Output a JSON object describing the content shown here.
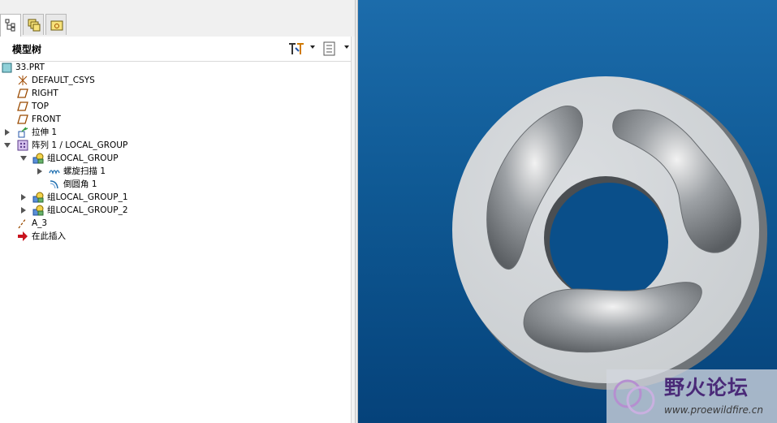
{
  "panel": {
    "title": "模型树"
  },
  "tabs": [
    {
      "icon": "model-tree-tab-icon",
      "active": true
    },
    {
      "icon": "layers-tab-icon",
      "active": false
    },
    {
      "icon": "folder-tab-icon",
      "active": false
    }
  ],
  "tree": {
    "root": "33.PRT",
    "items": [
      {
        "label": "DEFAULT_CSYS",
        "icon": "csys-icon"
      },
      {
        "label": "RIGHT",
        "icon": "datum-plane-icon"
      },
      {
        "label": "TOP",
        "icon": "datum-plane-icon"
      },
      {
        "label": "FRONT",
        "icon": "datum-plane-icon"
      },
      {
        "label": "拉伸 1",
        "icon": "extrude-icon",
        "expander": "collapsed"
      },
      {
        "label": "阵列 1 / LOCAL_GROUP",
        "icon": "pattern-icon",
        "expander": "expanded"
      },
      {
        "label": "组LOCAL_GROUP",
        "icon": "group-icon",
        "expander": "expanded"
      },
      {
        "label": "螺旋扫描 1",
        "icon": "helical-sweep-icon",
        "expander": "collapsed"
      },
      {
        "label": "倒圆角 1",
        "icon": "round-icon"
      },
      {
        "label": "组LOCAL_GROUP_1",
        "icon": "group-icon",
        "expander": "collapsed"
      },
      {
        "label": "组LOCAL_GROUP_2",
        "icon": "group-icon",
        "expander": "collapsed"
      },
      {
        "label": "A_3",
        "icon": "datum-axis-icon"
      },
      {
        "label": "在此插入",
        "icon": "insert-here-icon"
      }
    ]
  },
  "watermark": {
    "title": "野火论坛",
    "url": "www.proewildfire.cn"
  },
  "colors": {
    "viewport_top": "#1c6cab",
    "viewport_bottom": "#05427a",
    "part": "#d2d6d9"
  }
}
